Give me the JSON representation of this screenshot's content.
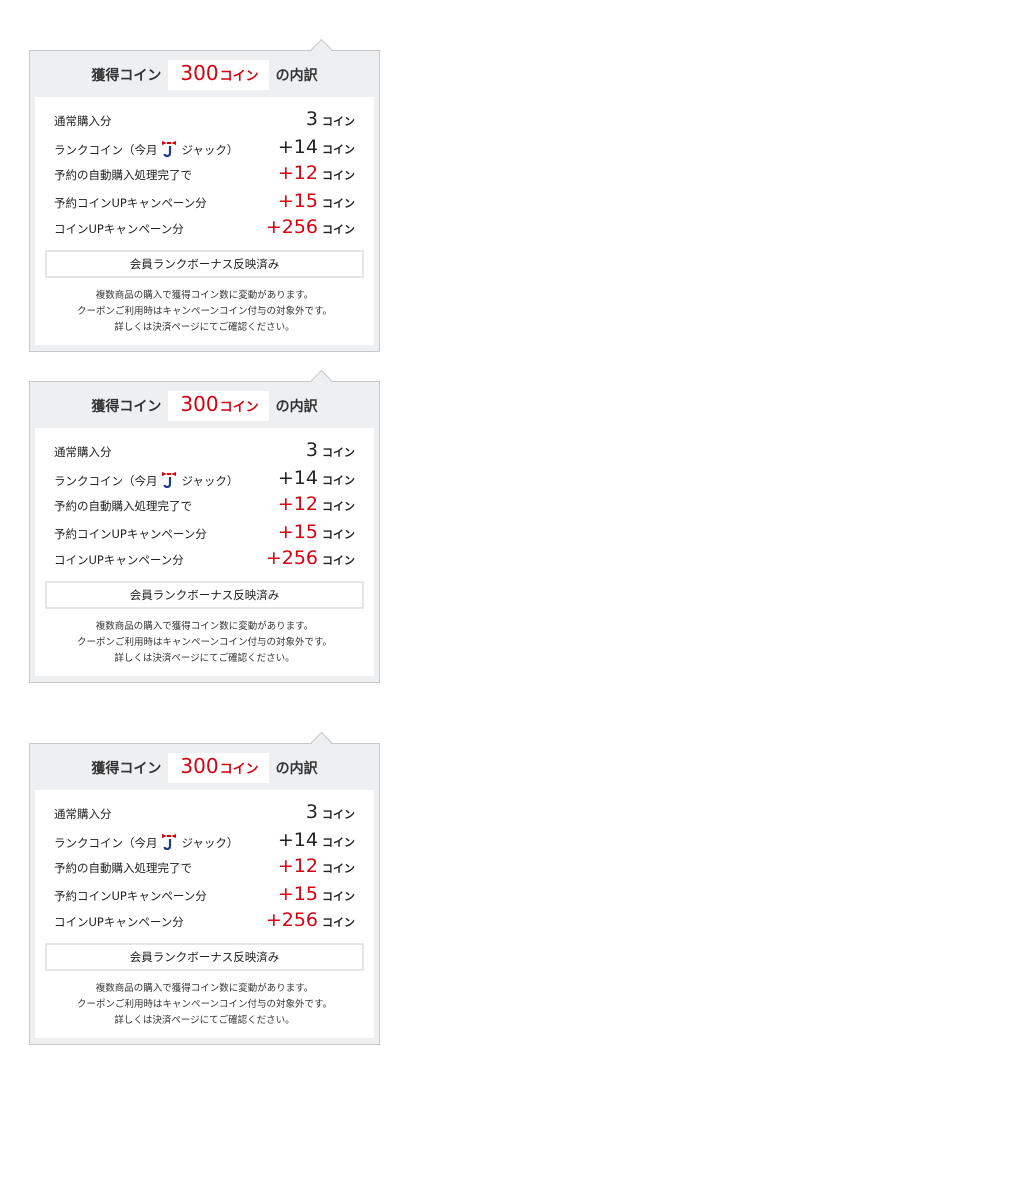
{
  "popups": [
    {
      "header": {
        "title": "獲得コイン",
        "total_value": "300",
        "total_unit": "コイン",
        "suffix": "の内訳"
      },
      "rows": [
        {
          "label": "通常購入分",
          "value": "3",
          "unit": "コイン"
        },
        {
          "label_prefix": "ランクコイン（今月",
          "rank_icon": "jack-rank-icon",
          "label_suffix": "ジャック）",
          "value": "+14",
          "unit": "コイン"
        },
        {
          "label": "予約の自動購入処理完了で",
          "value": "+12",
          "unit": "コイン"
        },
        {
          "label": "予約コインUPキャンペーン分",
          "value": "+15",
          "unit": "コイン"
        },
        {
          "label": "コインUPキャンペーン分",
          "value": "+256",
          "unit": "コイン"
        }
      ],
      "bonus_label": "会員ランクボーナス反映済み",
      "notes": [
        "複数商品の購入で獲得コイン数に変動があります。",
        "クーポンご利用時はキャンペーンコイン付与の対象外です。",
        "詳しくは決済ページにてご確認ください。"
      ]
    },
    {
      "header": {
        "title": "獲得コイン",
        "total_value": "300",
        "total_unit": "コイン",
        "suffix": "の内訳"
      },
      "rows": [
        {
          "label": "通常購入分",
          "value": "3",
          "unit": "コイン"
        },
        {
          "label_prefix": "ランクコイン（今月",
          "rank_icon": "jack-rank-icon",
          "label_suffix": "ジャック）",
          "value": "+14",
          "unit": "コイン"
        },
        {
          "label": "予約の自動購入処理完了で",
          "value": "+12",
          "unit": "コイン"
        },
        {
          "label": "予約コインUPキャンペーン分",
          "value": "+15",
          "unit": "コイン"
        },
        {
          "label": "コインUPキャンペーン分",
          "value": "+256",
          "unit": "コイン"
        }
      ],
      "bonus_label": "会員ランクボーナス反映済み",
      "notes": [
        "複数商品の購入で獲得コイン数に変動があります。",
        "クーポンご利用時はキャンペーンコイン付与の対象外です。",
        "詳しくは決済ページにてご確認ください。"
      ]
    },
    {
      "header": {
        "title": "獲得コイン",
        "total_value": "300",
        "total_unit": "コイン",
        "suffix": "の内訳"
      },
      "rows": [
        {
          "label": "通常購入分",
          "value": "3",
          "unit": "コイン"
        },
        {
          "label_prefix": "ランクコイン（今月",
          "rank_icon": "jack-rank-icon",
          "label_suffix": "ジャック）",
          "value": "+14",
          "unit": "コイン"
        },
        {
          "label": "予約の自動購入処理完了で",
          "value": "+12",
          "unit": "コイン"
        },
        {
          "label": "予約コインUPキャンペーン分",
          "value": "+15",
          "unit": "コイン"
        },
        {
          "label": "コインUPキャンペーン分",
          "value": "+256",
          "unit": "コイン"
        }
      ],
      "bonus_label": "会員ランクボーナス反映済み",
      "notes": [
        "複数商品の購入で獲得コイン数に変動があります。",
        "クーポンご利用時はキャンペーンコイン付与の対象外です。",
        "詳しくは決済ページにてご確認ください。"
      ]
    }
  ],
  "colors": {
    "accent_red": "#d7000f",
    "panel_gray": "#eeeff1",
    "border": "#c8c8c8",
    "rank_icon_blue": "#1f3a8a",
    "rank_icon_red": "#d7000f"
  }
}
